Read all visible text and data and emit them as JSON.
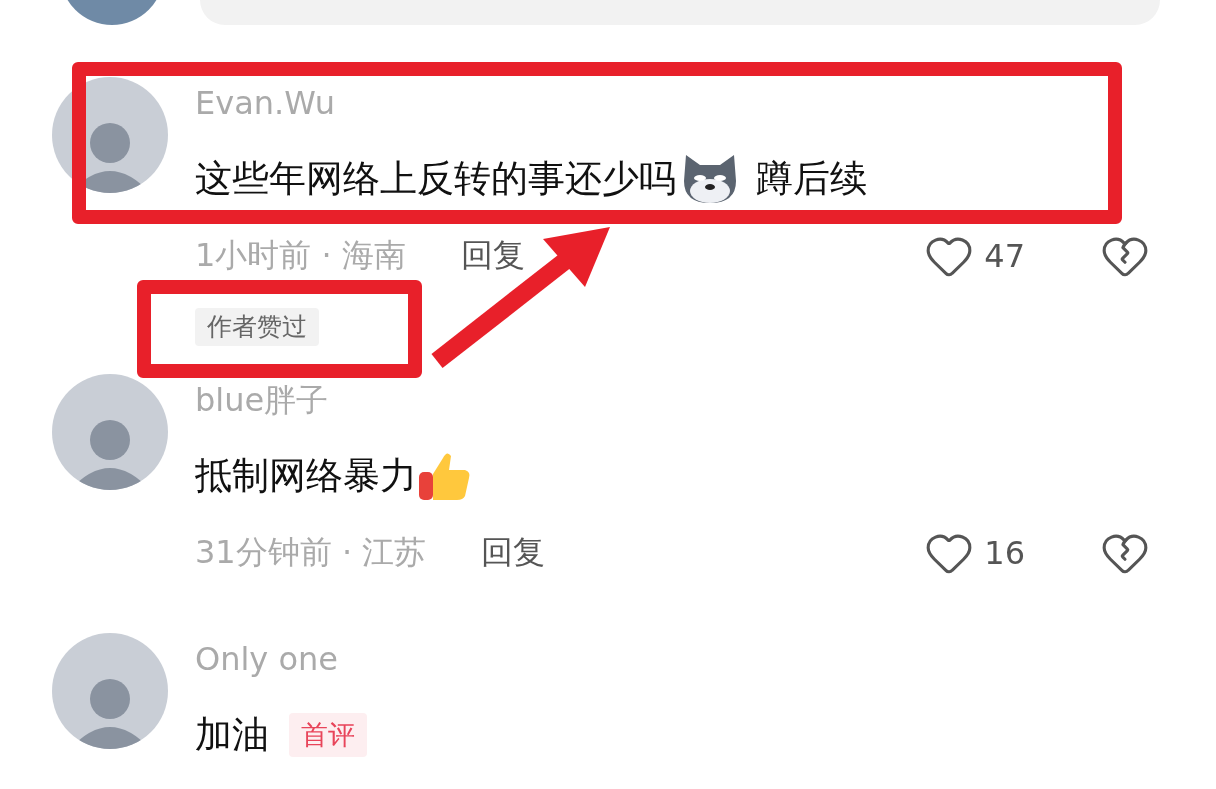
{
  "comments": [
    {
      "author": "Evan.Wu",
      "content": [
        {
          "kind": "text",
          "text": "这些年网络上反转的事还少吗"
        },
        {
          "kind": "wolf_emoji"
        },
        {
          "kind": "text",
          "text": " 蹲后续"
        }
      ],
      "meta": "1小时前 · 海南",
      "reply": "回复",
      "likes": "47",
      "liked": false,
      "badge": {
        "kind": "author_liked",
        "text": "作者赞过"
      }
    },
    {
      "author": "blue胖子",
      "content": [
        {
          "kind": "text",
          "text": "抵制网络暴力"
        },
        {
          "kind": "thumbs_up_emoji"
        }
      ],
      "meta": "31分钟前 · 江苏",
      "reply": "回复",
      "likes": "16",
      "liked": false
    },
    {
      "author": "Only one",
      "content": [
        {
          "kind": "text",
          "text": "加油"
        }
      ],
      "badge": {
        "kind": "first_comment",
        "text": "首评"
      }
    }
  ],
  "annotations": [
    {
      "kind": "box"
    },
    {
      "kind": "box"
    },
    {
      "kind": "arrow"
    }
  ]
}
